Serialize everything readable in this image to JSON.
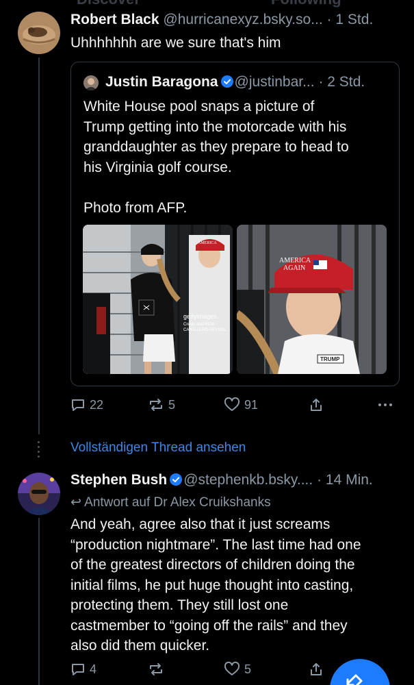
{
  "tabs": [
    {
      "label": "Discover"
    },
    {
      "label": "Following"
    }
  ],
  "post1": {
    "display_name": "Robert Black",
    "handle": "@hurricanexyz.bsky.so...",
    "time": "1 Std.",
    "text": "Uhhhhhhh are we sure that's him",
    "quote": {
      "display_name": "Justin Baragona",
      "handle": "@justinbar...",
      "time": "2 Std.",
      "text": "White House pool snaps a picture of\nTrump getting into the motorcade with his\ngranddaughter as they prepare to head to\nhis Virginia golf course.\n\nPhoto from AFP.",
      "photo_credit": {
        "brand": "gettyimages",
        "line1": "Credit: ANDREW",
        "line2": "CABALLERO-REYNOL"
      },
      "cap_text_left": "AMERICA GAIN",
      "cap_text_right": "AMERICA AGAIN",
      "shirt_text": "TRUMP"
    },
    "actions": {
      "replies": "22",
      "reposts": "5",
      "likes": "91"
    }
  },
  "view_thread_label": "Vollständigen Thread ansehen",
  "post2": {
    "display_name": "Stephen Bush",
    "handle": "@stephenkb.bsky....",
    "time": "14 Min.",
    "reply_to": "Antwort auf Dr Alex Cruikshanks",
    "text": "And yeah, agree also that it just screams\n“production nightmare”. The last time had one\nof the greatest directors of children doing the\ninitial films, he put huge thought into casting,\nprotecting them. They still lost one\ncastmember to “going off the rails”  and they\nalso did them quicker.",
    "actions": {
      "replies": "4",
      "reposts": "",
      "likes": "5"
    }
  },
  "colors": {
    "background": "#000000",
    "accent": "#3f86e6",
    "verified": "#1d7bff",
    "muted": "#8b98a5"
  }
}
